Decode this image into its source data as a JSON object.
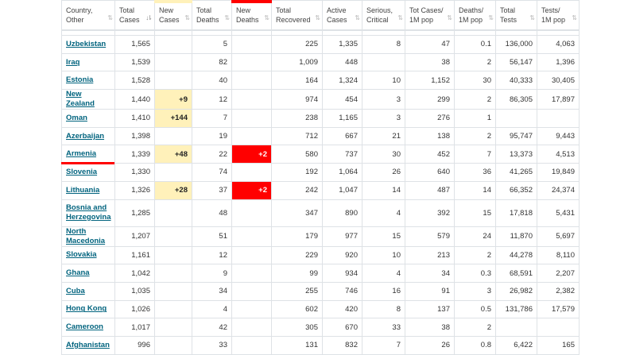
{
  "headers": [
    {
      "line1": "Country,",
      "line2": "Other",
      "sort": "⇅",
      "active": false
    },
    {
      "line1": "Total",
      "line2": "Cases",
      "sort": "↓⇂",
      "active": true
    },
    {
      "line1": "New",
      "line2": "Cases",
      "sort": "⇅",
      "active": false
    },
    {
      "line1": "Total",
      "line2": "Deaths",
      "sort": "⇅",
      "active": false
    },
    {
      "line1": "New",
      "line2": "Deaths",
      "sort": "⇅",
      "active": false
    },
    {
      "line1": "Total",
      "line2": "Recovered",
      "sort": "⇅",
      "active": false
    },
    {
      "line1": "Active",
      "line2": "Cases",
      "sort": "⇅",
      "active": false
    },
    {
      "line1": "Serious,",
      "line2": "Critical",
      "sort": "⇅",
      "active": false
    },
    {
      "line1": "Tot Cases/",
      "line2": "1M pop",
      "sort": "⇅",
      "active": false
    },
    {
      "line1": "Deaths/",
      "line2": "1M pop",
      "sort": "⇅",
      "active": false
    },
    {
      "line1": "Total",
      "line2": "Tests",
      "sort": "⇅",
      "active": false
    },
    {
      "line1": "Tests/",
      "line2": "1M pop",
      "sort": "⇅",
      "active": false
    }
  ],
  "rows": [
    {
      "country": "Uzbekistan",
      "total_cases": "1,565",
      "new_cases": "",
      "total_deaths": "5",
      "new_deaths": "",
      "total_recovered": "225",
      "active_cases": "1,335",
      "serious": "8",
      "cases_per_1m": "47",
      "deaths_per_1m": "0.1",
      "total_tests": "136,000",
      "tests_per_1m": "4,063"
    },
    {
      "country": "Iraq",
      "total_cases": "1,539",
      "new_cases": "",
      "total_deaths": "82",
      "new_deaths": "",
      "total_recovered": "1,009",
      "active_cases": "448",
      "serious": "",
      "cases_per_1m": "38",
      "deaths_per_1m": "2",
      "total_tests": "56,147",
      "tests_per_1m": "1,396"
    },
    {
      "country": "Estonia",
      "total_cases": "1,528",
      "new_cases": "",
      "total_deaths": "40",
      "new_deaths": "",
      "total_recovered": "164",
      "active_cases": "1,324",
      "serious": "10",
      "cases_per_1m": "1,152",
      "deaths_per_1m": "30",
      "total_tests": "40,333",
      "tests_per_1m": "30,405"
    },
    {
      "country": "New Zealand",
      "total_cases": "1,440",
      "new_cases": "+9",
      "total_deaths": "12",
      "new_deaths": "",
      "total_recovered": "974",
      "active_cases": "454",
      "serious": "3",
      "cases_per_1m": "299",
      "deaths_per_1m": "2",
      "total_tests": "86,305",
      "tests_per_1m": "17,897"
    },
    {
      "country": "Oman",
      "total_cases": "1,410",
      "new_cases": "+144",
      "total_deaths": "7",
      "new_deaths": "",
      "total_recovered": "238",
      "active_cases": "1,165",
      "serious": "3",
      "cases_per_1m": "276",
      "deaths_per_1m": "1",
      "total_tests": "",
      "tests_per_1m": ""
    },
    {
      "country": "Azerbaijan",
      "total_cases": "1,398",
      "new_cases": "",
      "total_deaths": "19",
      "new_deaths": "",
      "total_recovered": "712",
      "active_cases": "667",
      "serious": "21",
      "cases_per_1m": "138",
      "deaths_per_1m": "2",
      "total_tests": "95,747",
      "tests_per_1m": "9,443"
    },
    {
      "country": "Armenia",
      "total_cases": "1,339",
      "new_cases": "+48",
      "total_deaths": "22",
      "new_deaths": "+2",
      "total_recovered": "580",
      "active_cases": "737",
      "serious": "30",
      "cases_per_1m": "452",
      "deaths_per_1m": "7",
      "total_tests": "13,373",
      "tests_per_1m": "4,513"
    },
    {
      "country": "Slovenia",
      "total_cases": "1,330",
      "new_cases": "",
      "total_deaths": "74",
      "new_deaths": "",
      "total_recovered": "192",
      "active_cases": "1,064",
      "serious": "26",
      "cases_per_1m": "640",
      "deaths_per_1m": "36",
      "total_tests": "41,265",
      "tests_per_1m": "19,849"
    },
    {
      "country": "Lithuania",
      "total_cases": "1,326",
      "new_cases": "+28",
      "total_deaths": "37",
      "new_deaths": "+2",
      "total_recovered": "242",
      "active_cases": "1,047",
      "serious": "14",
      "cases_per_1m": "487",
      "deaths_per_1m": "14",
      "total_tests": "66,352",
      "tests_per_1m": "24,374"
    },
    {
      "country": "Bosnia and Herzegovina",
      "total_cases": "1,285",
      "new_cases": "",
      "total_deaths": "48",
      "new_deaths": "",
      "total_recovered": "347",
      "active_cases": "890",
      "serious": "4",
      "cases_per_1m": "392",
      "deaths_per_1m": "15",
      "total_tests": "17,818",
      "tests_per_1m": "5,431"
    },
    {
      "country": "North Macedonia",
      "total_cases": "1,207",
      "new_cases": "",
      "total_deaths": "51",
      "new_deaths": "",
      "total_recovered": "179",
      "active_cases": "977",
      "serious": "15",
      "cases_per_1m": "579",
      "deaths_per_1m": "24",
      "total_tests": "11,870",
      "tests_per_1m": "5,697"
    },
    {
      "country": "Slovakia",
      "total_cases": "1,161",
      "new_cases": "",
      "total_deaths": "12",
      "new_deaths": "",
      "total_recovered": "229",
      "active_cases": "920",
      "serious": "10",
      "cases_per_1m": "213",
      "deaths_per_1m": "2",
      "total_tests": "44,278",
      "tests_per_1m": "8,110"
    },
    {
      "country": "Ghana",
      "total_cases": "1,042",
      "new_cases": "",
      "total_deaths": "9",
      "new_deaths": "",
      "total_recovered": "99",
      "active_cases": "934",
      "serious": "4",
      "cases_per_1m": "34",
      "deaths_per_1m": "0.3",
      "total_tests": "68,591",
      "tests_per_1m": "2,207"
    },
    {
      "country": "Cuba",
      "total_cases": "1,035",
      "new_cases": "",
      "total_deaths": "34",
      "new_deaths": "",
      "total_recovered": "255",
      "active_cases": "746",
      "serious": "16",
      "cases_per_1m": "91",
      "deaths_per_1m": "3",
      "total_tests": "26,982",
      "tests_per_1m": "2,382"
    },
    {
      "country": "Hong Kong",
      "total_cases": "1,026",
      "new_cases": "",
      "total_deaths": "4",
      "new_deaths": "",
      "total_recovered": "602",
      "active_cases": "420",
      "serious": "8",
      "cases_per_1m": "137",
      "deaths_per_1m": "0.5",
      "total_tests": "131,786",
      "tests_per_1m": "17,579"
    },
    {
      "country": "Cameroon",
      "total_cases": "1,017",
      "new_cases": "",
      "total_deaths": "42",
      "new_deaths": "",
      "total_recovered": "305",
      "active_cases": "670",
      "serious": "33",
      "cases_per_1m": "38",
      "deaths_per_1m": "2",
      "total_tests": "",
      "tests_per_1m": ""
    },
    {
      "country": "Afghanistan",
      "total_cases": "996",
      "new_cases": "",
      "total_deaths": "33",
      "new_deaths": "",
      "total_recovered": "131",
      "active_cases": "832",
      "serious": "7",
      "cases_per_1m": "26",
      "deaths_per_1m": "0.8",
      "total_tests": "6,422",
      "tests_per_1m": "165"
    }
  ],
  "highlight_colors": {
    "new_cases": "#fff1ba",
    "new_deaths": "#ff0000",
    "link": "#00637e"
  }
}
